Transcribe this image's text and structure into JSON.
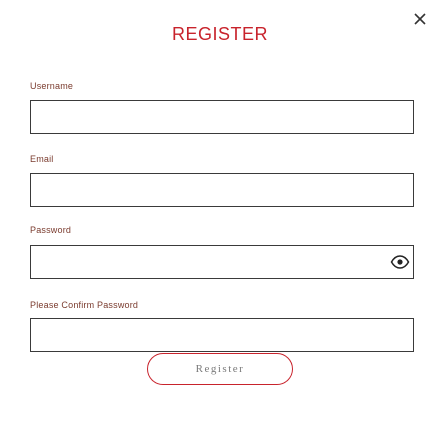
{
  "dialog": {
    "title": "REGISTER",
    "close_icon": "close-icon"
  },
  "fields": {
    "username": {
      "label": "Username",
      "value": "",
      "placeholder": ""
    },
    "email": {
      "label": "Email",
      "value": "",
      "placeholder": ""
    },
    "password": {
      "label": "Password",
      "value": "",
      "placeholder": "",
      "toggle_icon": "eye-icon"
    },
    "confirm_password": {
      "label": "Please Confirm Password",
      "value": "",
      "placeholder": ""
    }
  },
  "actions": {
    "register_label": "Register"
  },
  "colors": {
    "accent": "#c8232c",
    "label": "#7a3b2e",
    "border": "#3a3a3a",
    "button_text": "#7a7a7a"
  }
}
